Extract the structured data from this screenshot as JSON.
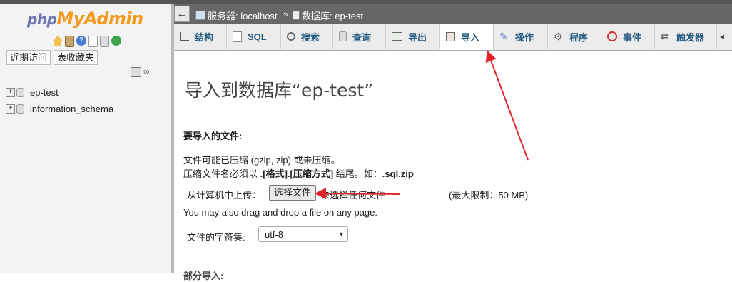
{
  "app": {
    "logo_php": "php",
    "logo_ma": "MyAdmin"
  },
  "sidebar": {
    "buttons": [
      "近期访问",
      "表收藏夹"
    ],
    "databases": [
      "ep-test",
      "information_schema"
    ]
  },
  "breadcrumb": {
    "server": "服务器: localhost",
    "sep": "»",
    "database": "数据库: ep-test"
  },
  "tabs": [
    {
      "label": "结构",
      "icon": "structure-icon"
    },
    {
      "label": "SQL",
      "icon": "sql-icon"
    },
    {
      "label": "搜索",
      "icon": "search-icon"
    },
    {
      "label": "查询",
      "icon": "query-icon"
    },
    {
      "label": "导出",
      "icon": "export-icon"
    },
    {
      "label": "导入",
      "icon": "import-icon",
      "active": true
    },
    {
      "label": "操作",
      "icon": "wrench-icon"
    },
    {
      "label": "程序",
      "icon": "routines-icon"
    },
    {
      "label": "事件",
      "icon": "events-icon"
    },
    {
      "label": "触发器",
      "icon": "triggers-icon"
    }
  ],
  "main": {
    "title": "导入到数据库“ep-test”",
    "section_legend": "要导入的文件:",
    "line1": "文件可能已压缩 (gzip, zip) 或未压缩。",
    "line2_pre": "压缩文件名必须以 ",
    "line2_bold": ".[格式].[压缩方式]",
    "line2_mid": " 结尾。如：",
    "line2_example": ".sql.zip",
    "upload_label": "从计算机中上传：",
    "choose_file": "选择文件",
    "no_file": "未选择任何文件",
    "max_limit": "(最大限制：50 MB)",
    "drag_text": "You may also drag and drop a file on any page.",
    "charset_label": "文件的字符集:",
    "charset_value": "utf-8",
    "partial_label": "部分导入:"
  },
  "colors": {
    "annotation": "#e0262a",
    "link": "#235a81"
  }
}
